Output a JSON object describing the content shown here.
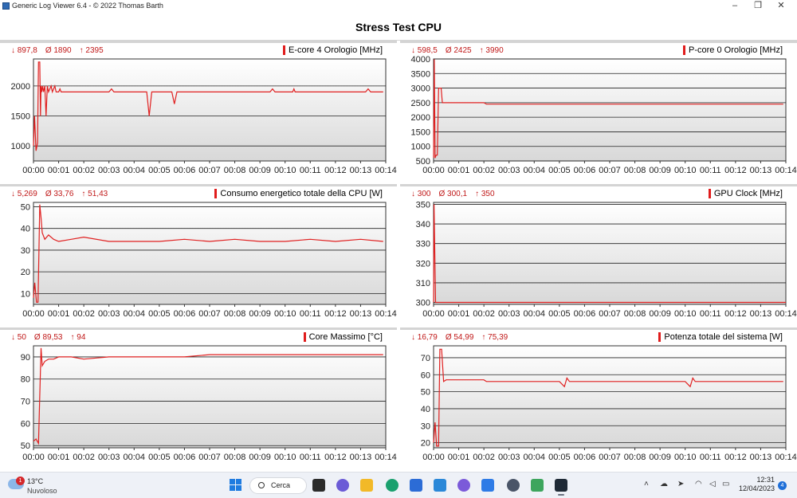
{
  "window": {
    "title": "Generic Log Viewer 6.4 - © 2022 Thomas Barth",
    "minimize": "–",
    "maximize": "❐",
    "close": "✕"
  },
  "header": {
    "title": "Stress Test CPU"
  },
  "x_ticks": [
    "00:00",
    "00:01",
    "00:02",
    "00:03",
    "00:04",
    "00:05",
    "00:06",
    "00:07",
    "00:08",
    "00:09",
    "00:10",
    "00:11",
    "00:12",
    "00:13",
    "00:14"
  ],
  "panels": [
    {
      "title": "E-core 4 Orologio [MHz]",
      "min": "↓ 897,8",
      "avg": "Ø 1890",
      "max": "↑ 2395"
    },
    {
      "title": "P-core 0 Orologio [MHz]",
      "min": "↓ 598,5",
      "avg": "Ø 2425",
      "max": "↑ 3990"
    },
    {
      "title": "Consumo energetico totale della CPU [W]",
      "min": "↓ 5,269",
      "avg": "Ø 33,76",
      "max": "↑ 51,43"
    },
    {
      "title": "GPU Clock [MHz]",
      "min": "↓ 300",
      "avg": "Ø 300,1",
      "max": "↑ 350"
    },
    {
      "title": "Core Massimo [°C]",
      "min": "↓ 50",
      "avg": "Ø 89,53",
      "max": "↑ 94"
    },
    {
      "title": "Potenza totale del sistema [W]",
      "min": "↓ 16,79",
      "avg": "Ø 54,99",
      "max": "↑ 75,39"
    }
  ],
  "chart_data": [
    {
      "type": "line",
      "title": "E-core 4 Orologio [MHz]",
      "ylim": [
        750,
        2450
      ],
      "yticks": [
        1000,
        1500,
        2000
      ],
      "series": [
        {
          "name": "E-core 4 Orologio [MHz]",
          "points": [
            [
              0,
              1000
            ],
            [
              0.04,
              1500
            ],
            [
              0.1,
              920
            ],
            [
              0.16,
              1050
            ],
            [
              0.2,
              2400
            ],
            [
              0.25,
              2400
            ],
            [
              0.28,
              1500
            ],
            [
              0.3,
              2000
            ],
            [
              0.33,
              1900
            ],
            [
              0.36,
              2000
            ],
            [
              0.4,
              1900
            ],
            [
              0.45,
              2000
            ],
            [
              0.5,
              1500
            ],
            [
              0.55,
              2000
            ],
            [
              0.6,
              1900
            ],
            [
              0.7,
              2000
            ],
            [
              0.75,
              1900
            ],
            [
              0.85,
              2000
            ],
            [
              0.9,
              1900
            ],
            [
              1.0,
              1900
            ],
            [
              1.05,
              1950
            ],
            [
              1.1,
              1900
            ],
            [
              2.0,
              1900
            ],
            [
              3.0,
              1900
            ],
            [
              3.1,
              1950
            ],
            [
              3.2,
              1900
            ],
            [
              4.0,
              1900
            ],
            [
              4.5,
              1900
            ],
            [
              4.6,
              1500
            ],
            [
              4.7,
              1900
            ],
            [
              5.5,
              1900
            ],
            [
              5.6,
              1700
            ],
            [
              5.7,
              1900
            ],
            [
              6.0,
              1900
            ],
            [
              7.0,
              1900
            ],
            [
              8.0,
              1900
            ],
            [
              9.0,
              1900
            ],
            [
              9.4,
              1900
            ],
            [
              9.5,
              1950
            ],
            [
              9.6,
              1900
            ],
            [
              10.3,
              1900
            ],
            [
              10.35,
              1950
            ],
            [
              10.4,
              1900
            ],
            [
              13.2,
              1900
            ],
            [
              13.3,
              1950
            ],
            [
              13.4,
              1900
            ],
            [
              13.9,
              1900
            ]
          ]
        }
      ]
    },
    {
      "type": "line",
      "title": "P-core 0 Orologio [MHz]",
      "ylim": [
        500,
        4000
      ],
      "yticks": [
        500,
        1000,
        1500,
        2000,
        2500,
        3000,
        3500,
        4000
      ],
      "series": [
        {
          "name": "P-core 0 Orologio [MHz]",
          "points": [
            [
              0,
              600
            ],
            [
              0.03,
              3990
            ],
            [
              0.06,
              600
            ],
            [
              0.1,
              700
            ],
            [
              0.15,
              700
            ],
            [
              0.2,
              3000
            ],
            [
              0.3,
              3000
            ],
            [
              0.35,
              2500
            ],
            [
              0.5,
              2500
            ],
            [
              1.0,
              2500
            ],
            [
              2.0,
              2500
            ],
            [
              2.1,
              2450
            ],
            [
              2.5,
              2450
            ],
            [
              3.0,
              2450
            ],
            [
              4.0,
              2450
            ],
            [
              5.0,
              2450
            ],
            [
              6.0,
              2450
            ],
            [
              7.0,
              2450
            ],
            [
              8.0,
              2450
            ],
            [
              9.0,
              2450
            ],
            [
              10.0,
              2450
            ],
            [
              11.0,
              2450
            ],
            [
              12.0,
              2450
            ],
            [
              13.0,
              2450
            ],
            [
              13.9,
              2450
            ]
          ]
        }
      ]
    },
    {
      "type": "line",
      "title": "Consumo energetico totale della CPU [W]",
      "ylim": [
        5,
        52
      ],
      "yticks": [
        10,
        20,
        30,
        40,
        50
      ],
      "series": [
        {
          "name": "Consumo energetico totale della CPU [W]",
          "points": [
            [
              0,
              8
            ],
            [
              0.05,
              15
            ],
            [
              0.12,
              6
            ],
            [
              0.18,
              6
            ],
            [
              0.25,
              51
            ],
            [
              0.3,
              45
            ],
            [
              0.35,
              38
            ],
            [
              0.45,
              35
            ],
            [
              0.6,
              37
            ],
            [
              0.8,
              35
            ],
            [
              1.0,
              34
            ],
            [
              1.5,
              35
            ],
            [
              2.0,
              36
            ],
            [
              3.0,
              34
            ],
            [
              4.0,
              34
            ],
            [
              5.0,
              34
            ],
            [
              6.0,
              35
            ],
            [
              7.0,
              34
            ],
            [
              8.0,
              35
            ],
            [
              9.0,
              34
            ],
            [
              10.0,
              34
            ],
            [
              11.0,
              35
            ],
            [
              12.0,
              34
            ],
            [
              13.0,
              35
            ],
            [
              13.9,
              34
            ]
          ]
        }
      ]
    },
    {
      "type": "line",
      "title": "GPU Clock [MHz]",
      "ylim": [
        299,
        351
      ],
      "yticks": [
        300,
        310,
        320,
        330,
        340,
        350
      ],
      "series": [
        {
          "name": "GPU Clock [MHz]",
          "points": [
            [
              0,
              300
            ],
            [
              0.02,
              350
            ],
            [
              0.08,
              300
            ],
            [
              1.0,
              300
            ],
            [
              14.0,
              300
            ]
          ]
        }
      ]
    },
    {
      "type": "line",
      "title": "Core Massimo [°C]",
      "ylim": [
        49,
        95
      ],
      "yticks": [
        50,
        60,
        70,
        80,
        90
      ],
      "series": [
        {
          "name": "Core Massimo [°C]",
          "points": [
            [
              0,
              52
            ],
            [
              0.1,
              53
            ],
            [
              0.2,
              51
            ],
            [
              0.3,
              94
            ],
            [
              0.35,
              86
            ],
            [
              0.45,
              88
            ],
            [
              0.6,
              89
            ],
            [
              0.8,
              89
            ],
            [
              1.0,
              90
            ],
            [
              1.5,
              90
            ],
            [
              2.0,
              89
            ],
            [
              3.0,
              90
            ],
            [
              4.0,
              90
            ],
            [
              5.0,
              90
            ],
            [
              6.0,
              90
            ],
            [
              7.0,
              91
            ],
            [
              8.0,
              91
            ],
            [
              9.0,
              91
            ],
            [
              10.0,
              91
            ],
            [
              11.0,
              91
            ],
            [
              12.0,
              91
            ],
            [
              13.0,
              91
            ],
            [
              13.9,
              91
            ]
          ]
        }
      ]
    },
    {
      "type": "line",
      "title": "Potenza totale del sistema [W]",
      "ylim": [
        17,
        77
      ],
      "yticks": [
        20,
        30,
        40,
        50,
        60,
        70
      ],
      "series": [
        {
          "name": "Potenza totale del sistema [W]",
          "points": [
            [
              0,
              20
            ],
            [
              0.06,
              32
            ],
            [
              0.12,
              18
            ],
            [
              0.2,
              18
            ],
            [
              0.25,
              75
            ],
            [
              0.32,
              75
            ],
            [
              0.4,
              56
            ],
            [
              0.5,
              57
            ],
            [
              1.0,
              57
            ],
            [
              2.0,
              57
            ],
            [
              2.1,
              56
            ],
            [
              3.0,
              56
            ],
            [
              4.0,
              56
            ],
            [
              5.0,
              56
            ],
            [
              5.2,
              53
            ],
            [
              5.3,
              58
            ],
            [
              5.4,
              56
            ],
            [
              6.0,
              56
            ],
            [
              7.0,
              56
            ],
            [
              8.0,
              56
            ],
            [
              9.0,
              56
            ],
            [
              10.0,
              56
            ],
            [
              10.2,
              53
            ],
            [
              10.3,
              58
            ],
            [
              10.4,
              56
            ],
            [
              11.0,
              56
            ],
            [
              12.0,
              56
            ],
            [
              13.0,
              56
            ],
            [
              13.9,
              56
            ]
          ]
        }
      ]
    }
  ],
  "taskbar": {
    "weather_temp": "13°C",
    "weather_cond": "Nuvoloso",
    "weather_badge": "1",
    "search_label": "Cerca",
    "clock_time": "12:31",
    "clock_date": "12/04/2023",
    "notif_count": "4"
  }
}
